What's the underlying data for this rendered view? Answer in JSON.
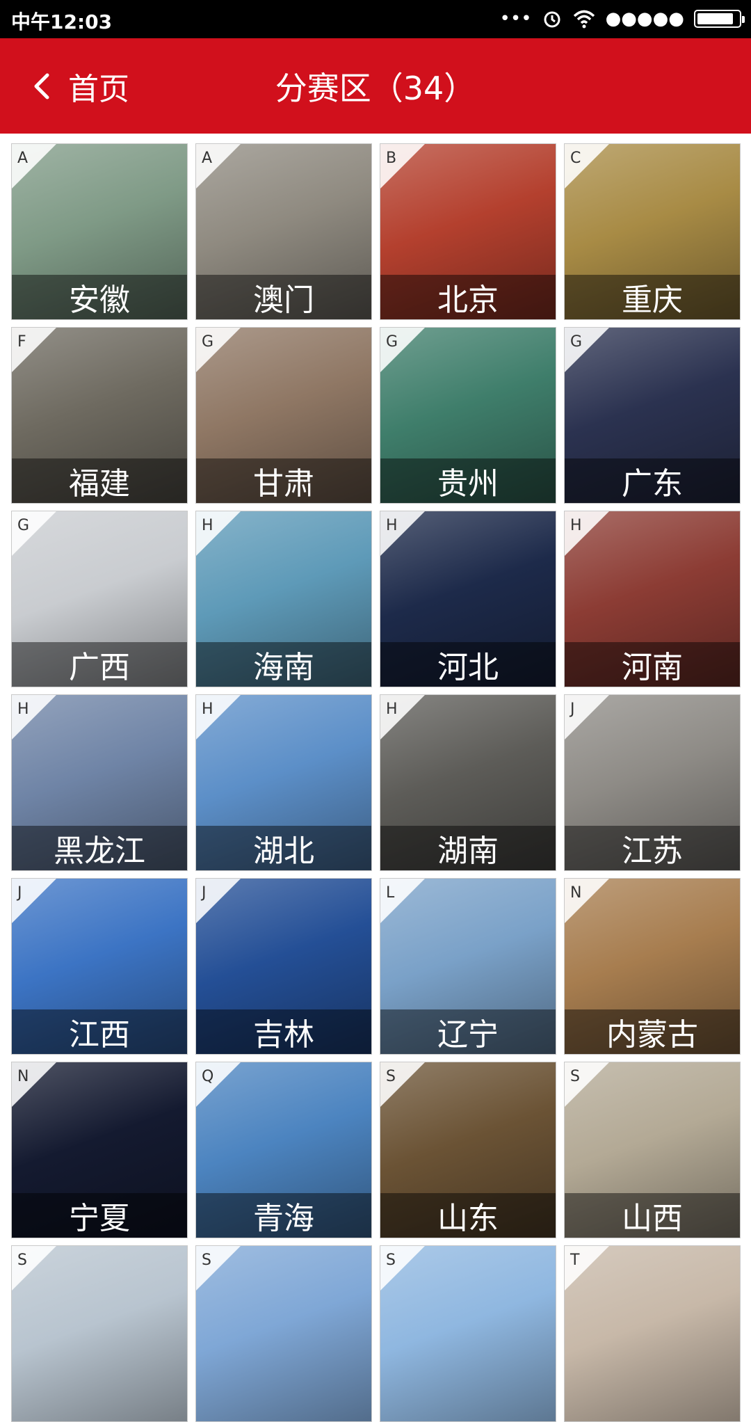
{
  "status": {
    "time": "中午12:03",
    "signal": "●●●●●"
  },
  "header": {
    "back_label": "首页",
    "title": "分赛区（34）"
  },
  "tiles": [
    {
      "letter": "A",
      "name": "安徽",
      "bg": "#7f9a86"
    },
    {
      "letter": "A",
      "name": "澳门",
      "bg": "#8f8a80"
    },
    {
      "letter": "B",
      "name": "北京",
      "bg": "#b4402e"
    },
    {
      "letter": "C",
      "name": "重庆",
      "bg": "#a88b45"
    },
    {
      "letter": "F",
      "name": "福建",
      "bg": "#6e6a60"
    },
    {
      "letter": "G",
      "name": "甘肃",
      "bg": "#8f7764"
    },
    {
      "letter": "G",
      "name": "贵州",
      "bg": "#3f7e6b"
    },
    {
      "letter": "G",
      "name": "广东",
      "bg": "#2b3250"
    },
    {
      "letter": "G",
      "name": "广西",
      "bg": "#c9ccd0"
    },
    {
      "letter": "H",
      "name": "海南",
      "bg": "#5e9ab8"
    },
    {
      "letter": "H",
      "name": "河北",
      "bg": "#1d2a4a"
    },
    {
      "letter": "H",
      "name": "河南",
      "bg": "#8c3c34"
    },
    {
      "letter": "H",
      "name": "黑龙江",
      "bg": "#6f84a6"
    },
    {
      "letter": "H",
      "name": "湖北",
      "bg": "#5c8fc8"
    },
    {
      "letter": "H",
      "name": "湖南",
      "bg": "#5d5c58"
    },
    {
      "letter": "J",
      "name": "江苏",
      "bg": "#8e8b86"
    },
    {
      "letter": "J",
      "name": "江西",
      "bg": "#3c74c4"
    },
    {
      "letter": "J",
      "name": "吉林",
      "bg": "#244f96"
    },
    {
      "letter": "L",
      "name": "辽宁",
      "bg": "#7aa1c8"
    },
    {
      "letter": "N",
      "name": "内蒙古",
      "bg": "#a77d4f"
    },
    {
      "letter": "N",
      "name": "宁夏",
      "bg": "#141a30"
    },
    {
      "letter": "Q",
      "name": "青海",
      "bg": "#4c84c0"
    },
    {
      "letter": "S",
      "name": "山东",
      "bg": "#6b5335"
    },
    {
      "letter": "S",
      "name": "山西",
      "bg": "#b3a995"
    },
    {
      "letter": "S",
      "name": "",
      "bg": "#b8c4cf"
    },
    {
      "letter": "S",
      "name": "",
      "bg": "#7fa7d6"
    },
    {
      "letter": "S",
      "name": "",
      "bg": "#8fb7e0"
    },
    {
      "letter": "T",
      "name": "",
      "bg": "#c7b8a8"
    }
  ]
}
